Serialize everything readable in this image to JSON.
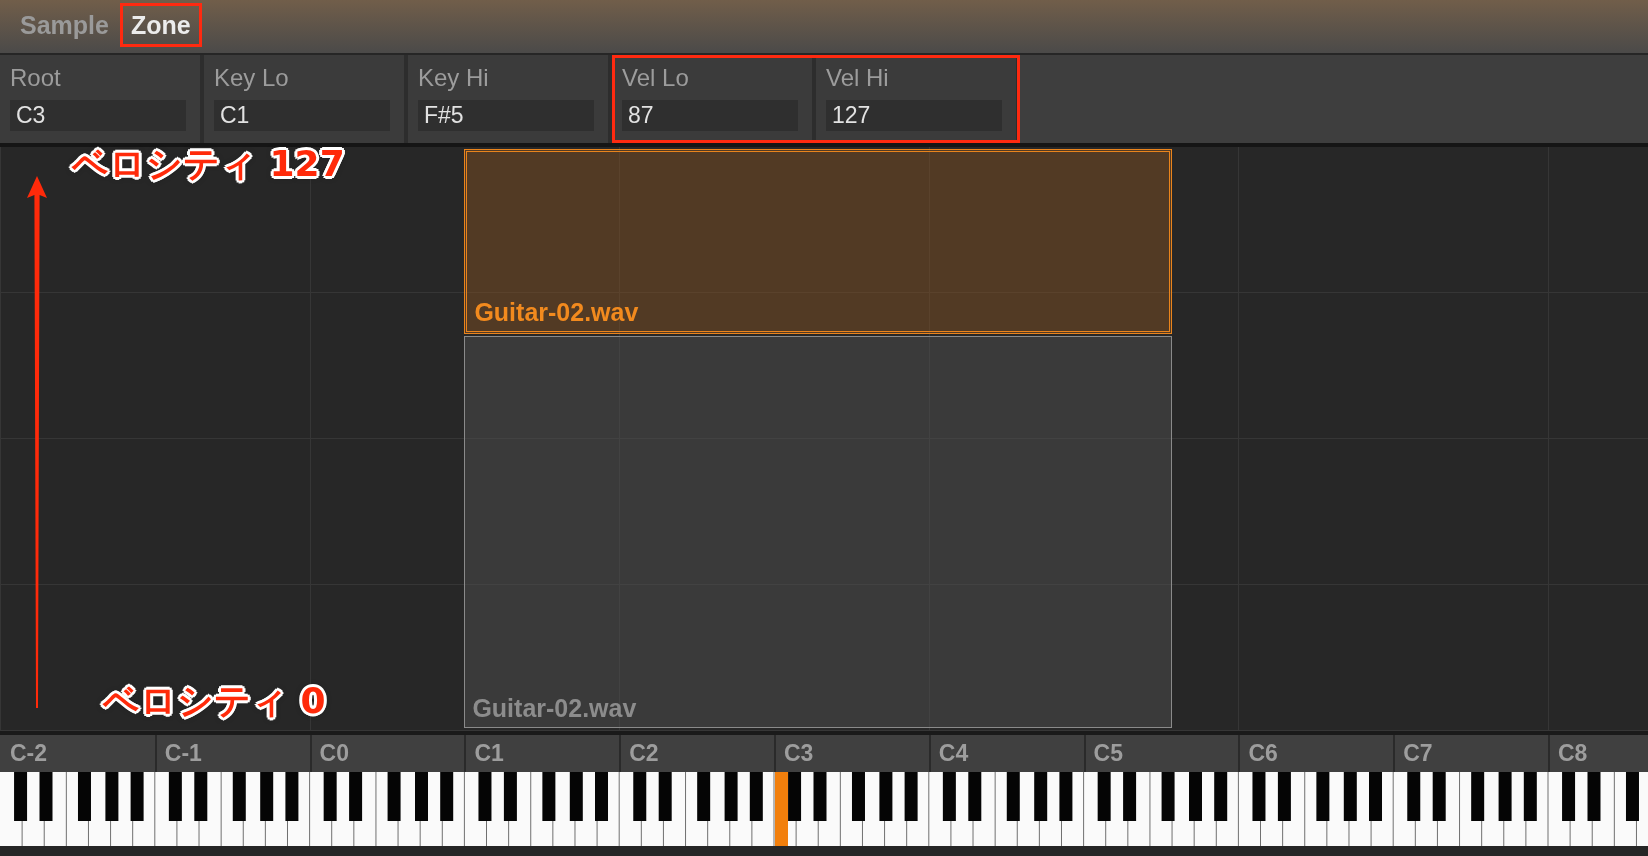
{
  "tabs": [
    {
      "label": "Sample",
      "selected": false,
      "highlighted": false
    },
    {
      "label": "Zone",
      "selected": true,
      "highlighted": true
    }
  ],
  "fields": [
    {
      "label": "Root",
      "value": "C3",
      "highlighted": false
    },
    {
      "label": "Key Lo",
      "value": "C1",
      "highlighted": false
    },
    {
      "label": "Key Hi",
      "value": "F#5",
      "highlighted": false
    },
    {
      "label": "Vel Lo",
      "value": "87",
      "highlighted": true
    },
    {
      "label": "Vel Hi",
      "value": "127",
      "highlighted": true
    }
  ],
  "zone_map": {
    "zones": [
      {
        "label": "Guitar-02.wav",
        "selected": true
      },
      {
        "label": "Guitar-02.wav",
        "selected": false
      }
    ]
  },
  "velocity_annotations": [
    "ベロシティ 127",
    "ベロシティ 0"
  ],
  "keyboard": {
    "octaves": [
      {
        "label": "C-2",
        "root_marked": false
      },
      {
        "label": "C-1",
        "root_marked": false
      },
      {
        "label": "C0",
        "root_marked": false
      },
      {
        "label": "C1",
        "root_marked": false
      },
      {
        "label": "C2",
        "root_marked": false
      },
      {
        "label": "C3",
        "root_marked": true
      },
      {
        "label": "C4",
        "root_marked": false
      },
      {
        "label": "C5",
        "root_marked": false
      },
      {
        "label": "C6",
        "root_marked": false
      },
      {
        "label": "C7",
        "root_marked": false
      },
      {
        "label": "C8",
        "root_marked": false
      }
    ]
  }
}
